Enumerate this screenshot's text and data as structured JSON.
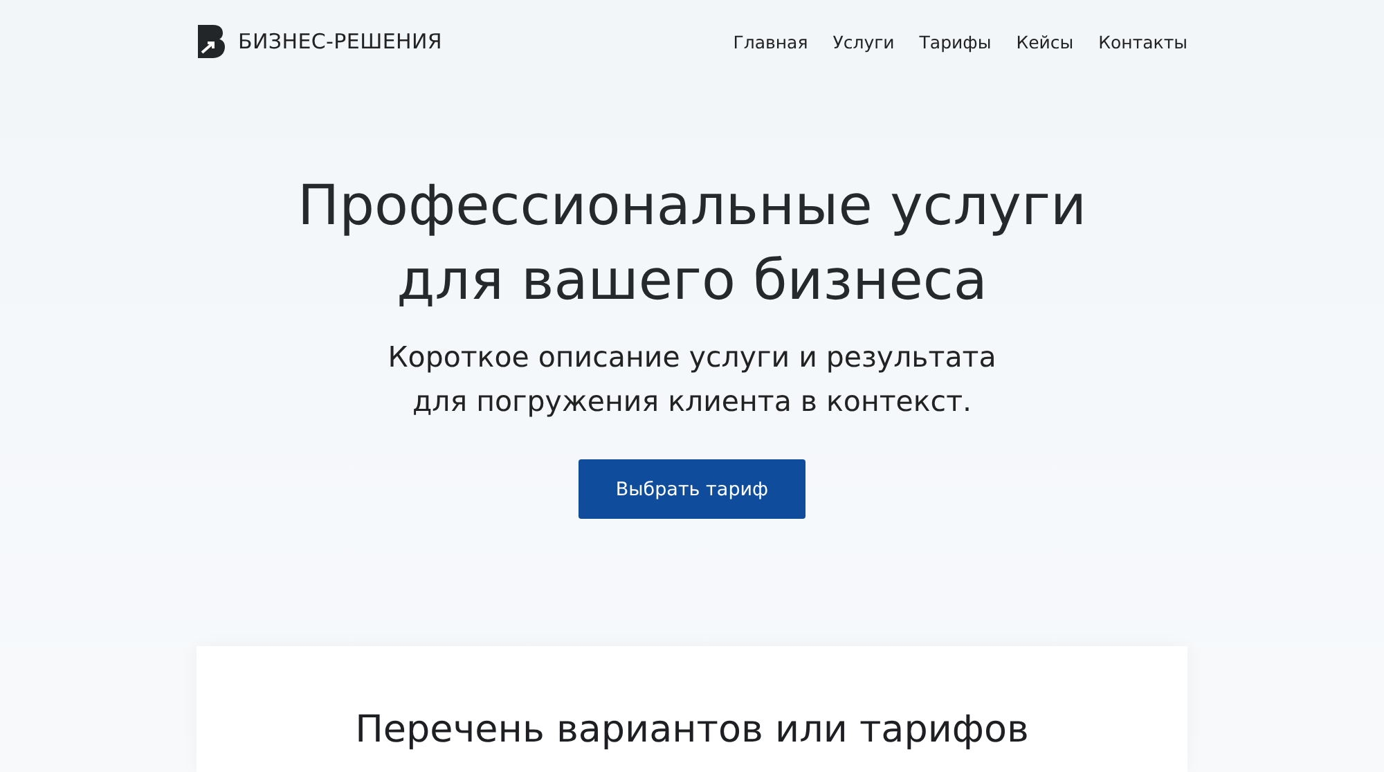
{
  "header": {
    "logo_text": "БИЗНЕС-РЕШЕНИЯ",
    "nav": [
      {
        "label": "Главная"
      },
      {
        "label": "Услуги"
      },
      {
        "label": "Тарифы"
      },
      {
        "label": "Кейсы"
      },
      {
        "label": "Контакты"
      }
    ]
  },
  "hero": {
    "title_lines": [
      "Профессиональные услуги",
      "для вашего бизнеса"
    ],
    "subtitle_lines": [
      "Короткое описание услуги и результата",
      "для погружения клиента в контекст."
    ],
    "button": "Выбрать тариф"
  },
  "card": {
    "heading": "Перечень вариантов или тарифов"
  }
}
